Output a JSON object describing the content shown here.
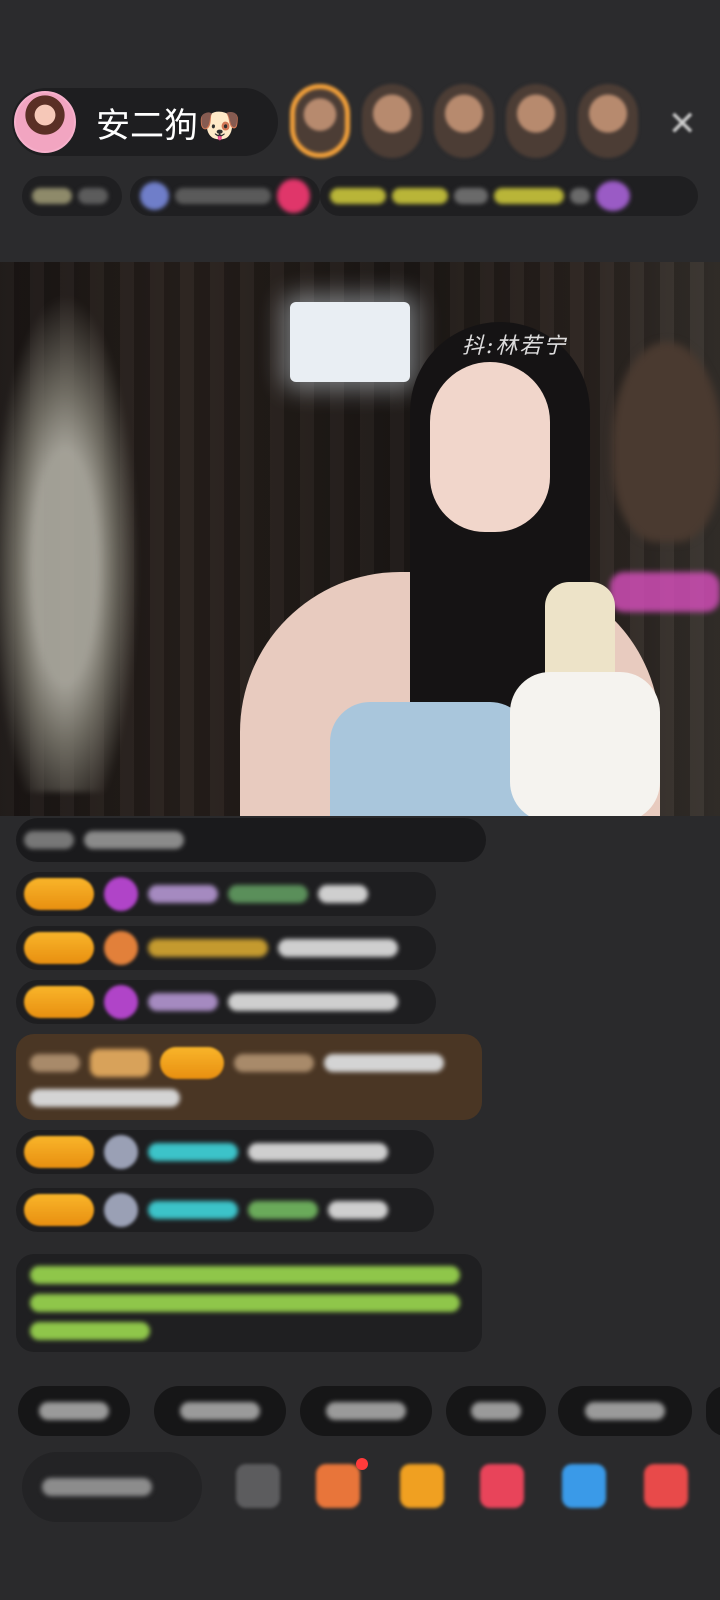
{
  "header": {
    "anchor_name": "安二狗",
    "anchor_emoji": "🐶",
    "close_symbol": "✕"
  },
  "icons": {
    "close": "close-icon",
    "gift": "gift-icon",
    "more": "more-icon"
  },
  "colors": {
    "background": "#2a2a2c",
    "level_badge": "#f4a11e",
    "gold_message": "#4a3624",
    "chat_bubble": "#1e1e20",
    "chat_green_text": "#8fc64a",
    "chat_cyan_name": "#3cc3c9"
  },
  "video": {
    "watermark": "抖:林若宁"
  },
  "input": {
    "placeholder": ""
  }
}
